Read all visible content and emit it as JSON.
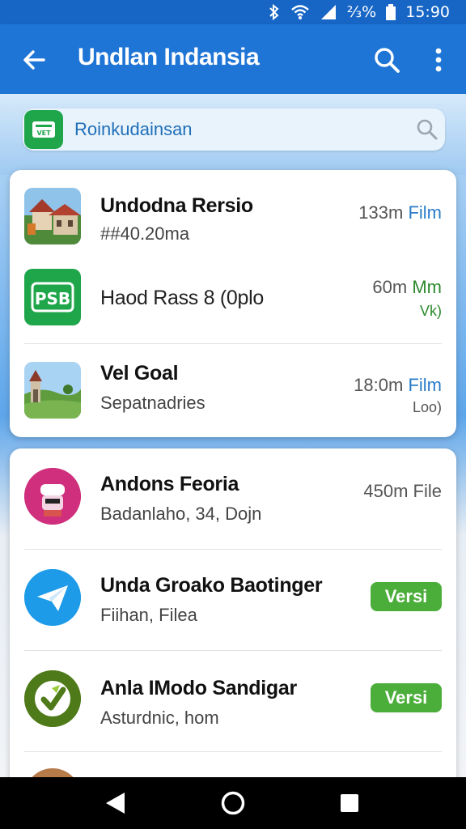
{
  "status_bar": {
    "battery": "⅔%",
    "time": "15:90"
  },
  "app_bar": {
    "title": "Undlan Indansia"
  },
  "search": {
    "query": "Roinkudainsan",
    "badge_label": "VET"
  },
  "colors": {
    "primary": "#1f75d6",
    "accent_green": "#4cae3a",
    "link_blue": "#2a7cc8"
  },
  "list_group_1": [
    {
      "name": "Undodna Rersio",
      "subtitle": "##40.20ma",
      "meta_size": "133m",
      "meta_suffix": "Film",
      "icon": "house-photo-thumbnail"
    },
    {
      "name": "Haod Rass 8 (0plo",
      "meta_size": "60m",
      "meta_suffix": "Mm",
      "meta_line2": "Vk)",
      "icon": "green-app-icon",
      "icon_label": "PSB"
    },
    {
      "name": "Vel Goal",
      "subtitle": "Sepatnadries",
      "meta_size": "18:0m",
      "meta_suffix": "Film",
      "meta_line2": "Loo)",
      "icon": "landscape-photo-thumbnail"
    }
  ],
  "list_group_2": [
    {
      "name": "Andons Feoria",
      "subtitle": "Badanlaho, 34, Doјn",
      "meta": "450m File",
      "icon": "pink-mascot-icon"
    },
    {
      "name": "Unda Groako Baotinger",
      "subtitle": "Fiihan, Filea",
      "badge": "Versi",
      "icon": "blue-paper-plane-icon"
    },
    {
      "name": "Anla IModo Sandigar",
      "subtitle": "Asturdnic, hom",
      "badge": "Versi",
      "icon": "olive-leaf-icon"
    }
  ],
  "nav_bar": {
    "buttons": [
      "back",
      "home",
      "recents"
    ]
  }
}
